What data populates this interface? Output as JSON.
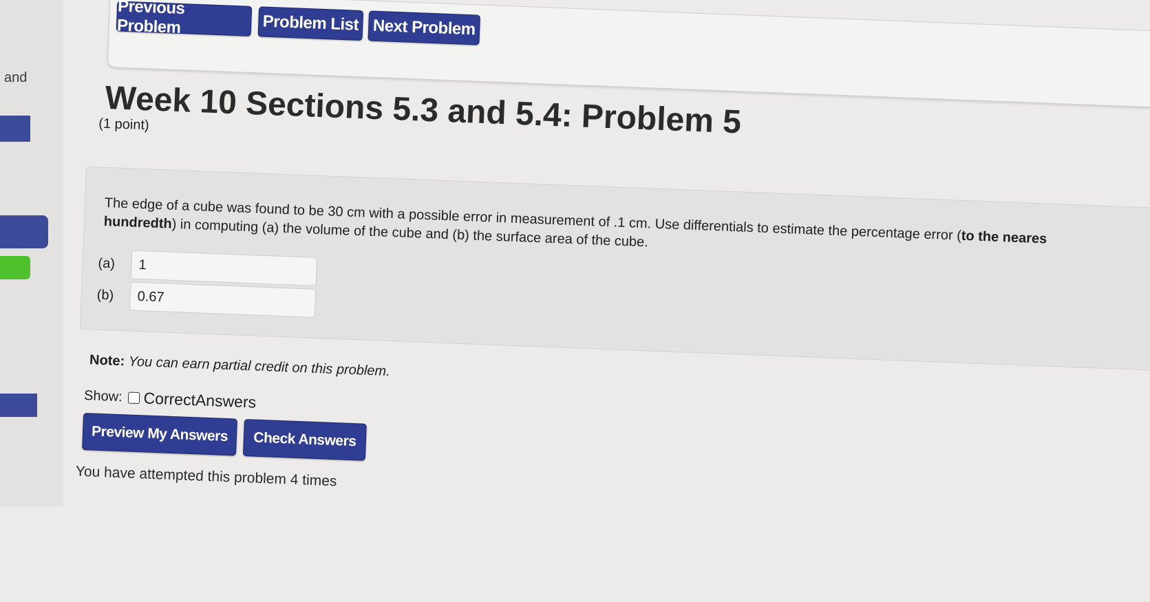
{
  "sidebar": {
    "partial_text": "and"
  },
  "nav": {
    "previous_label": "Previous Problem",
    "list_label": "Problem List",
    "next_label": "Next Problem"
  },
  "problem": {
    "title": "Week 10 Sections 5.3 and 5.4: Problem 5",
    "points": "(1 point)",
    "text_line1": "The edge of a cube was found to be 30 cm with a possible error in measurement of .1 cm. Use differentials to estimate the percentage error (",
    "text_bold_1": "to the neares",
    "text_bold_2": "hundredth",
    "text_line2": ") in computing (a) the volume of the cube and (b) the surface area of the cube.",
    "answers": [
      {
        "label": "(a)",
        "value": "1"
      },
      {
        "label": "(b)",
        "value": "0.67"
      }
    ]
  },
  "note": {
    "label": "Note:",
    "text": "You can earn partial credit on this problem."
  },
  "show": {
    "label": "Show:",
    "option": "CorrectAnswers"
  },
  "actions": {
    "preview_label": "Preview My Answers",
    "check_label": "Check Answers"
  },
  "status": {
    "attempts_text": "You have attempted this problem 4 times"
  },
  "colors": {
    "button_bg": "#2f3d92",
    "accent_green": "#4fc12c"
  }
}
